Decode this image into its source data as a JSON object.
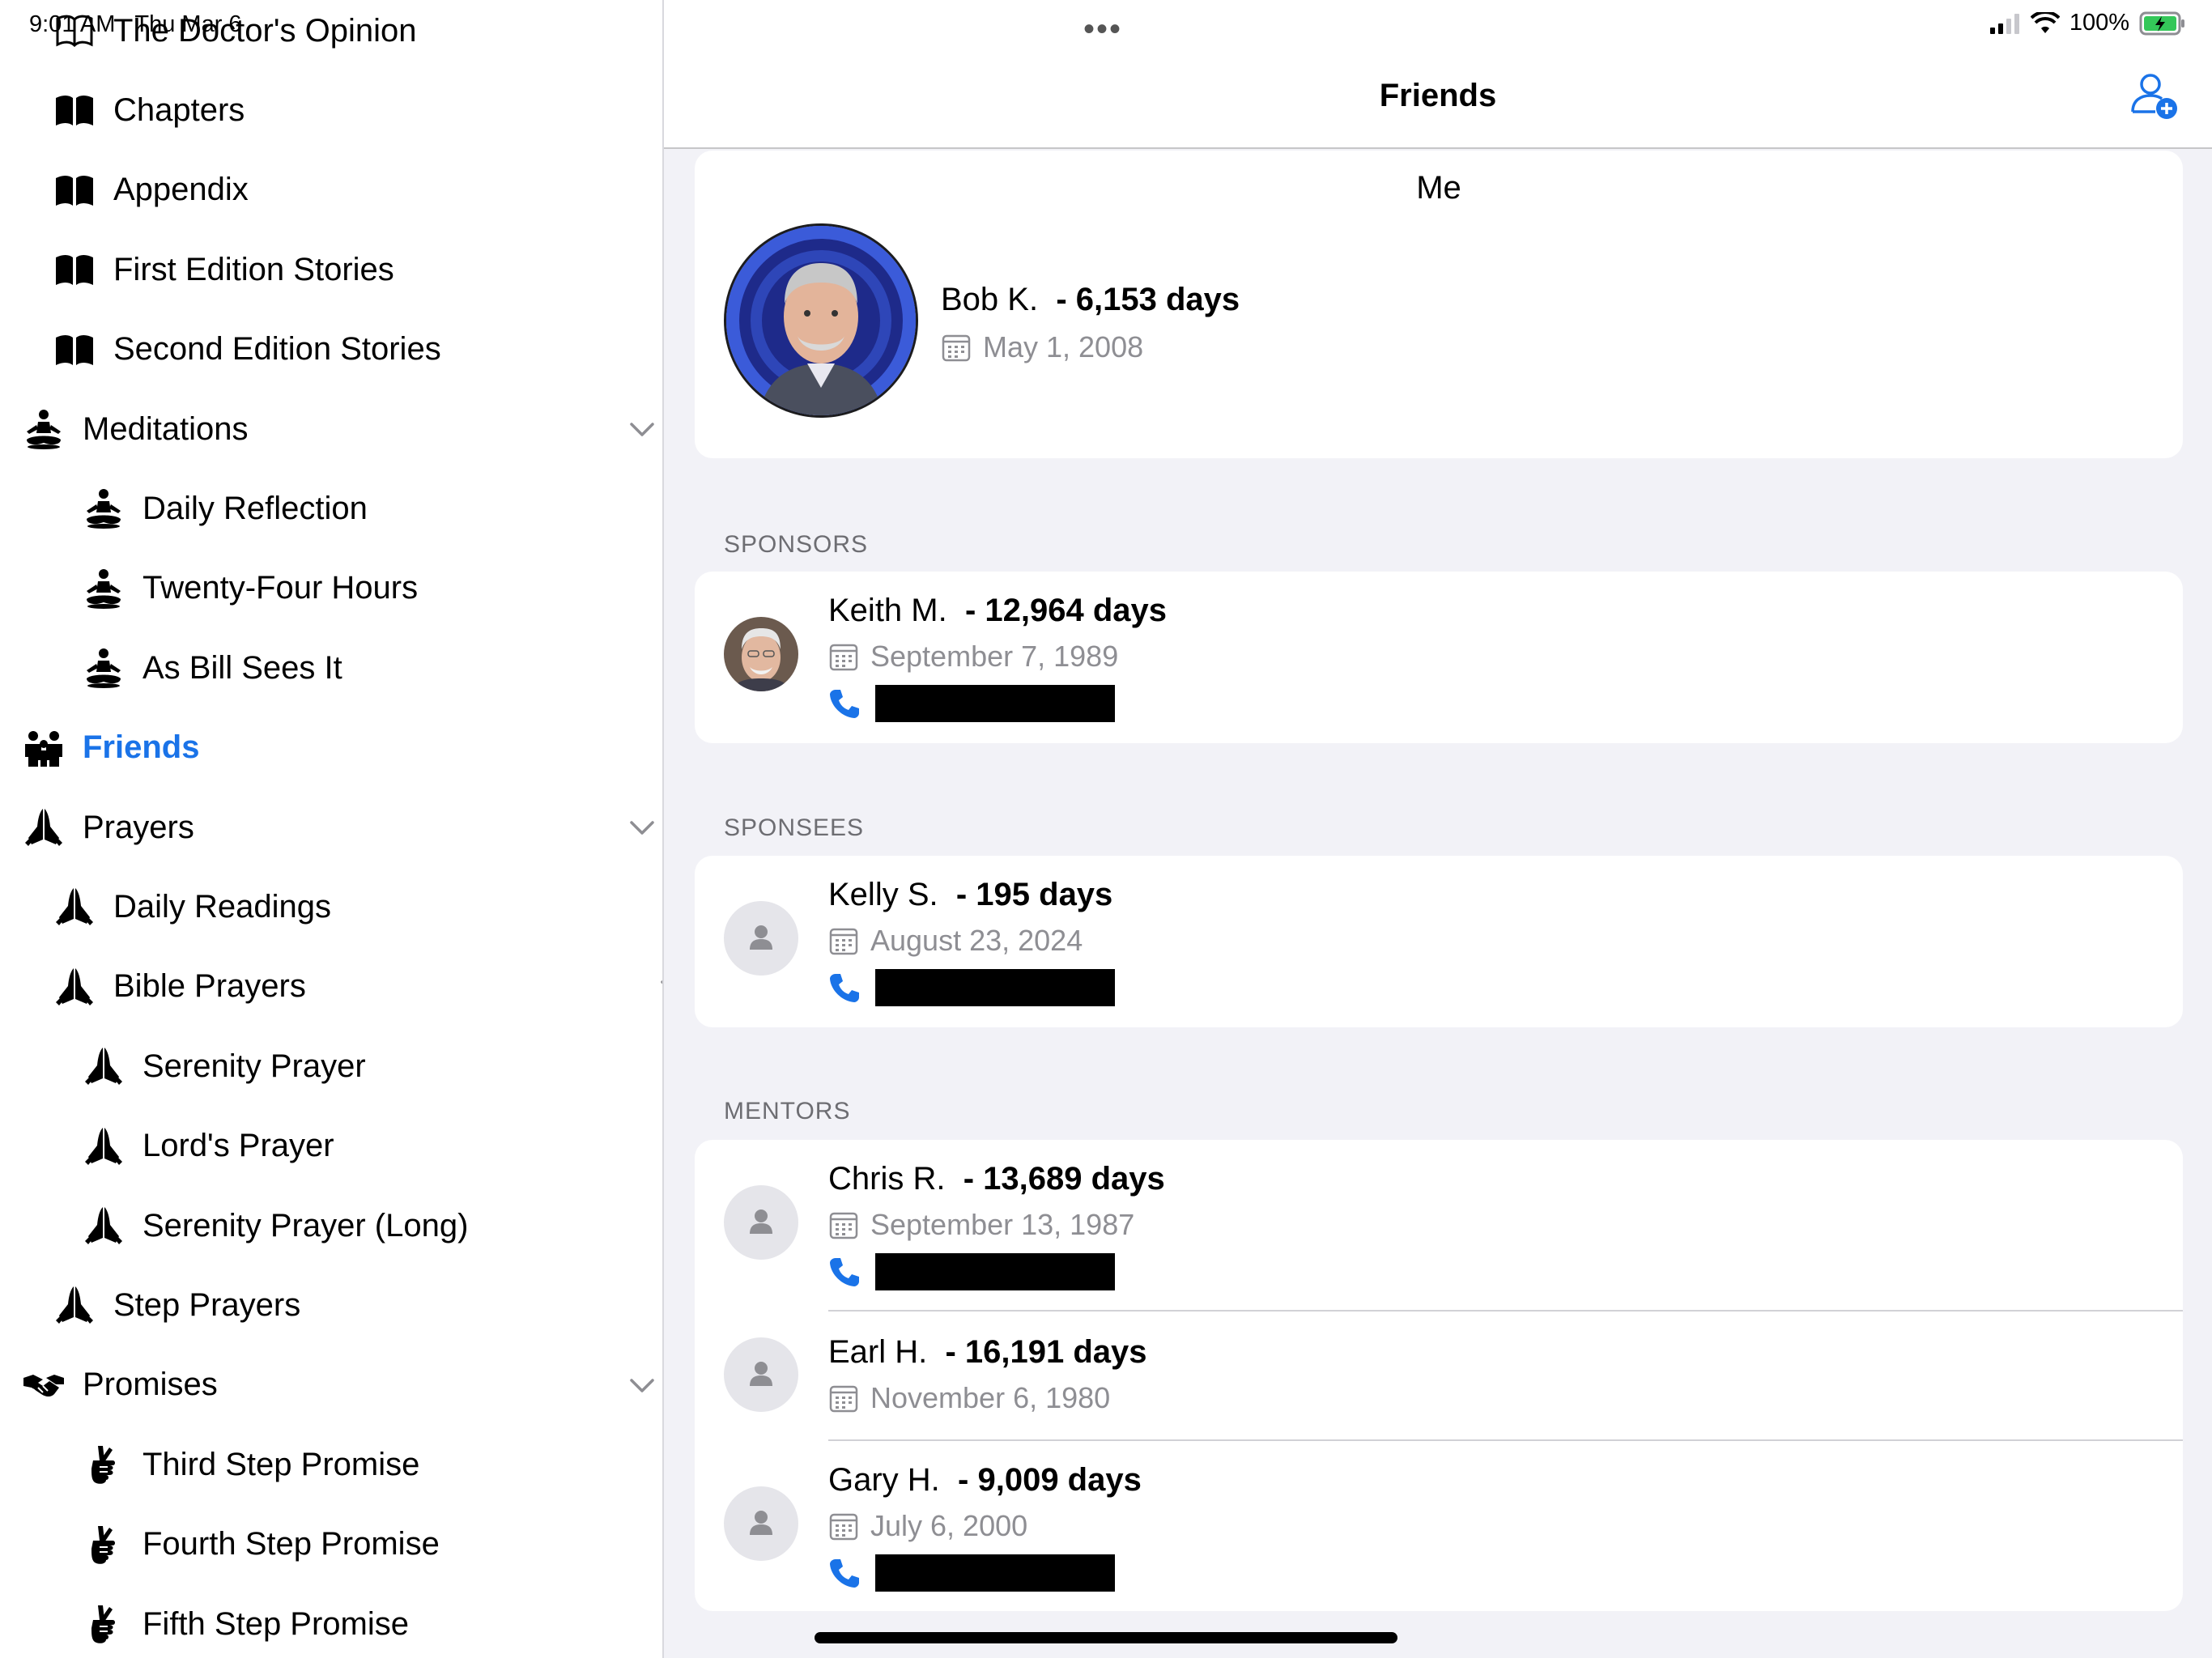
{
  "status_bar": {
    "time": "9:01 AM",
    "date": "Thu Mar 6",
    "battery": "100%"
  },
  "sidebar": {
    "items": [
      {
        "label": "The Doctor's Opinion",
        "icon": "book-outline-icon",
        "level": 1,
        "chevron": "none"
      },
      {
        "label": "Chapters",
        "icon": "book-icon",
        "level": 1,
        "chevron": "right"
      },
      {
        "label": "Appendix",
        "icon": "book-icon",
        "level": 1,
        "chevron": "right"
      },
      {
        "label": "First Edition Stories",
        "icon": "book-icon",
        "level": 1,
        "chevron": "right"
      },
      {
        "label": "Second Edition Stories",
        "icon": "book-icon",
        "level": 1,
        "chevron": "right"
      },
      {
        "label": "Meditations",
        "icon": "meditation-icon",
        "level": 0,
        "chevron": "down"
      },
      {
        "label": "Daily Reflection",
        "icon": "meditation-icon",
        "level": 2,
        "chevron": "none"
      },
      {
        "label": "Twenty-Four Hours",
        "icon": "meditation-icon",
        "level": 2,
        "chevron": "none"
      },
      {
        "label": "As Bill Sees It",
        "icon": "meditation-icon",
        "level": 2,
        "chevron": "none"
      },
      {
        "label": "Friends",
        "icon": "people-icon",
        "level": 0,
        "chevron": "none",
        "active": true
      },
      {
        "label": "Prayers",
        "icon": "praying-hands-icon",
        "level": 0,
        "chevron": "down"
      },
      {
        "label": "Daily Readings",
        "icon": "praying-hands-icon",
        "level": 1,
        "chevron": "right"
      },
      {
        "label": "Bible Prayers",
        "icon": "praying-hands-icon",
        "level": 1,
        "chevron": "down"
      },
      {
        "label": "Serenity Prayer",
        "icon": "praying-hands-icon",
        "level": 2,
        "chevron": "none"
      },
      {
        "label": "Lord's Prayer",
        "icon": "praying-hands-icon",
        "level": 2,
        "chevron": "none"
      },
      {
        "label": "Serenity Prayer (Long)",
        "icon": "praying-hands-icon",
        "level": 2,
        "chevron": "none"
      },
      {
        "label": "Step Prayers",
        "icon": "praying-hands-icon",
        "level": 1,
        "chevron": "right"
      },
      {
        "label": "Promises",
        "icon": "handshake-icon",
        "level": 0,
        "chevron": "down"
      },
      {
        "label": "Third Step Promise",
        "icon": "crossed-fingers-icon",
        "level": 2,
        "chevron": "none"
      },
      {
        "label": "Fourth Step Promise",
        "icon": "crossed-fingers-icon",
        "level": 2,
        "chevron": "none"
      },
      {
        "label": "Fifth Step Promise",
        "icon": "crossed-fingers-icon",
        "level": 2,
        "chevron": "none"
      }
    ]
  },
  "header": {
    "title": "Friends",
    "add_icon": "add-person-icon"
  },
  "me": {
    "label": "Me",
    "name": "Bob K.",
    "days": "- 6,153 days",
    "date": "May 1, 2008"
  },
  "sponsors": {
    "header": "SPONSORS",
    "people": [
      {
        "name": "Keith M.",
        "days": "- 12,964 days",
        "date": "September 7, 1989",
        "photo": true,
        "phone": true
      }
    ]
  },
  "sponsees": {
    "header": "SPONSEES",
    "people": [
      {
        "name": "Kelly S.",
        "days": "- 195 days",
        "date": "August 23, 2024",
        "photo": false,
        "phone": true
      }
    ]
  },
  "mentors": {
    "header": "MENTORS",
    "people": [
      {
        "name": "Chris R.",
        "days": "- 13,689 days",
        "date": "September 13, 1987",
        "photo": false,
        "phone": true
      },
      {
        "name": "Earl H.",
        "days": "- 16,191 days",
        "date": "November 6, 1980",
        "photo": false,
        "phone": false
      },
      {
        "name": "Gary H.",
        "days": "- 9,009 days",
        "date": "July 6, 2000",
        "photo": false,
        "phone": true
      }
    ]
  },
  "colors": {
    "accent": "#1a73e8",
    "phone": "#1a73e8",
    "background": "#f2f2f7"
  }
}
